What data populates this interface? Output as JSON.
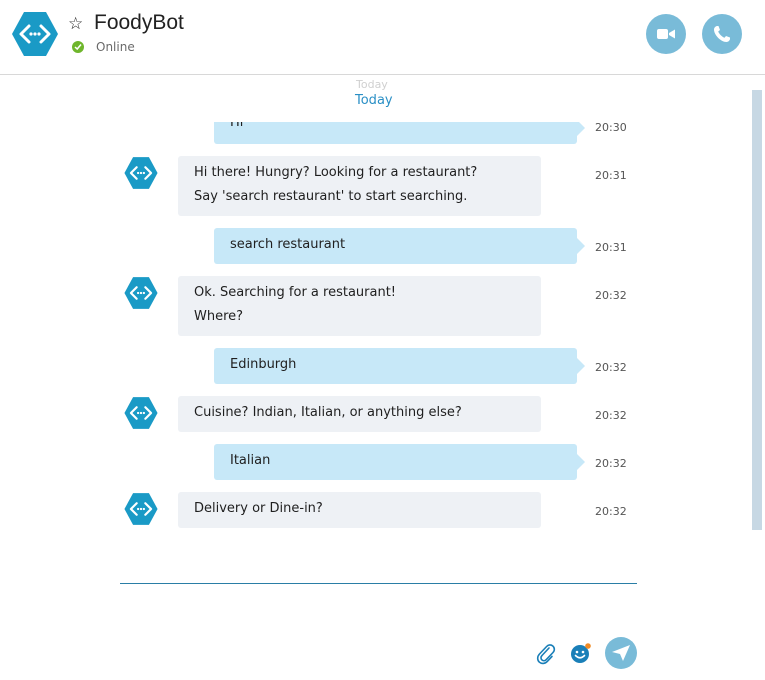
{
  "header": {
    "name": "FoodyBot",
    "status": "Online",
    "favorite_icon": "star-outline-icon",
    "video_icon": "video-camera-icon",
    "call_icon": "phone-icon"
  },
  "chat": {
    "date_separator": "Today",
    "date_separator_faded": "Today",
    "messages": [
      {
        "from": "user",
        "text": "Hi",
        "time": "20:30"
      },
      {
        "from": "bot",
        "lines": [
          "Hi there! Hungry? Looking for a restaurant?",
          "Say 'search restaurant' to start searching."
        ],
        "time": "20:31"
      },
      {
        "from": "user",
        "text": "search restaurant",
        "time": "20:31"
      },
      {
        "from": "bot",
        "lines": [
          "Ok. Searching for a restaurant!",
          "Where?"
        ],
        "time": "20:32"
      },
      {
        "from": "user",
        "text": "Edinburgh",
        "time": "20:32"
      },
      {
        "from": "bot",
        "lines": [
          "Cuisine? Indian, Italian, or anything else?"
        ],
        "time": "20:32"
      },
      {
        "from": "user",
        "text": "Italian",
        "time": "20:32"
      },
      {
        "from": "bot",
        "lines": [
          "Delivery or Dine-in?"
        ],
        "time": "20:32"
      }
    ]
  },
  "composer": {
    "attach_icon": "paperclip-icon",
    "emoji_icon": "emoji-icon",
    "send_icon": "send-icon"
  },
  "colors": {
    "accent": "#2a8fc5",
    "user_bubble": "#c7e8f8",
    "bot_bubble": "#eef1f5",
    "avatar": "#1a9ac6",
    "status_online": "#6fb62c"
  }
}
